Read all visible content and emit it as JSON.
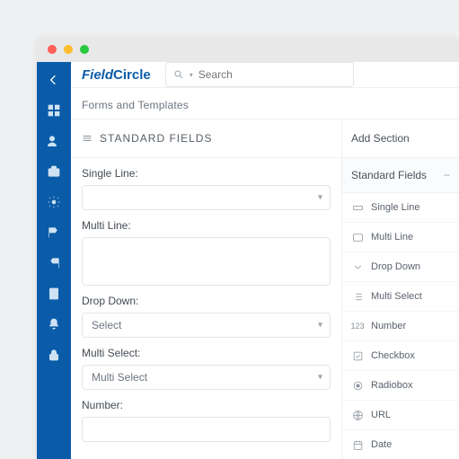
{
  "logo_a": "Field",
  "logo_b": "Circle",
  "search_placeholder": "Search",
  "breadcrumb": "Forms and Templates",
  "section_title": "STANDARD FIELDS",
  "fields": {
    "single_line": "Single Line:",
    "multi_line": "Multi Line:",
    "drop_down": "Drop Down:",
    "drop_down_val": "Select",
    "multi_select": "Multi Select:",
    "multi_select_val": "Multi Select",
    "number": "Number:"
  },
  "right": {
    "add_section": "Add Section",
    "panel_title": "Standard Fields"
  },
  "types": {
    "single_line": "Single Line",
    "multi_line": "Multi Line",
    "drop_down": "Drop Down",
    "multi_select": "Multi Select",
    "number": "Number",
    "checkbox": "Checkbox",
    "radiobox": "Radiobox",
    "url": "URL",
    "date": "Date"
  }
}
